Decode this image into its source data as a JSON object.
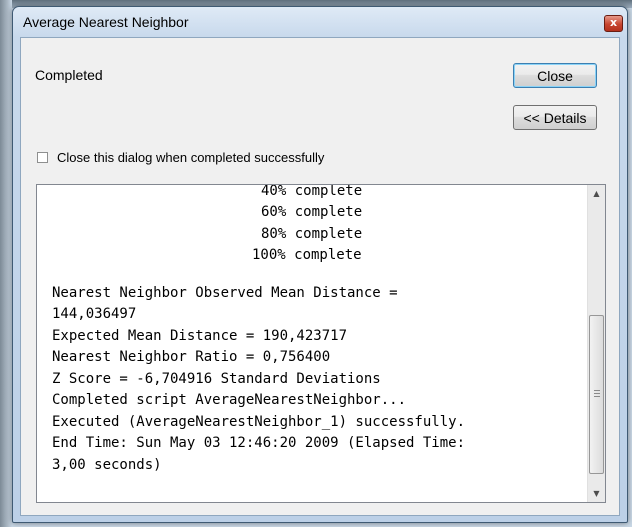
{
  "window": {
    "title": "Average Nearest Neighbor",
    "close_glyph": "x"
  },
  "status": {
    "text": "Completed"
  },
  "buttons": {
    "close_label": "Close",
    "details_label": "<< Details"
  },
  "options": {
    "close_when_done_label": "Close this dialog when completed successfully",
    "close_when_done_checked": false
  },
  "output": {
    "progress": [
      "40% complete",
      "60% complete",
      "80% complete",
      "100% complete"
    ],
    "result_lines": [
      "Nearest Neighbor Observed Mean Distance =",
      "144,036497",
      "Expected Mean Distance = 190,423717",
      "Nearest Neighbor Ratio = 0,756400",
      "Z Score = -6,704916 Standard Deviations",
      "Completed script AverageNearestNeighbor...",
      "Executed (AverageNearestNeighbor_1) successfully.",
      "End Time: Sun May 03 12:46:20 2009 (Elapsed Time:",
      "3,00 seconds)"
    ]
  },
  "icons": {
    "scroll_up": "scroll-up-arrow-icon",
    "scroll_down": "scroll-down-arrow-icon",
    "close": "close-icon"
  }
}
